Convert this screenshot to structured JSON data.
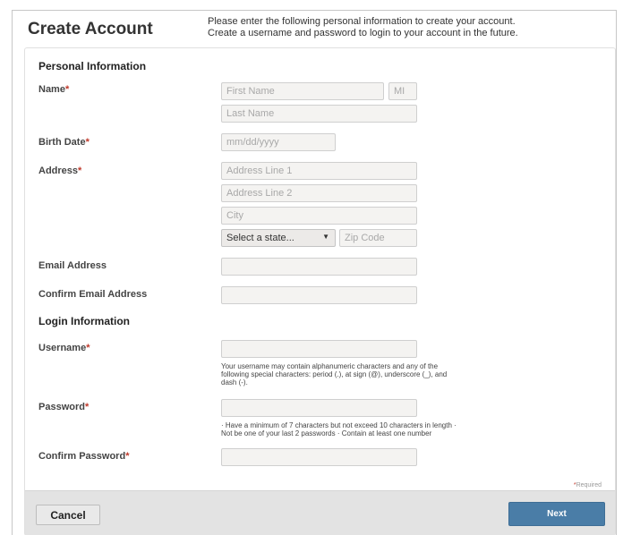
{
  "header": {
    "title": "Create Account",
    "intro_line1": "Please enter the following personal information to create your account.",
    "intro_line2": "Create a username and password to login to your account in the future."
  },
  "personal": {
    "section_title": "Personal Information",
    "name_label": "Name",
    "first_name_placeholder": "First Name",
    "mi_placeholder": "MI",
    "last_name_placeholder": "Last Name",
    "birth_date_label": "Birth Date",
    "birth_date_placeholder": "mm/dd/yyyy",
    "address_label": "Address",
    "address1_placeholder": "Address Line 1",
    "address2_placeholder": "Address Line 2",
    "city_placeholder": "City",
    "state_selected": "Select a state...",
    "zip_placeholder": "Zip Code",
    "email_label": "Email Address",
    "confirm_email_label": "Confirm Email Address"
  },
  "login": {
    "section_title": "Login Information",
    "username_label": "Username",
    "username_hint_line1": "Your username may contain alphanumeric characters and any of the",
    "username_hint_line2": "following special characters: period (.), at sign (@), underscore (_), and",
    "username_hint_line3": "dash (-).",
    "password_label": "Password",
    "password_hint_line1": "· Have a minimum of 7 characters but not exceed 10 characters in length ·",
    "password_hint_line2": "Not be one of your last 2 passwords · Contain at least one number",
    "confirm_password_label": "Confirm Password"
  },
  "required_marker": "*",
  "required_note": "Required",
  "footer": {
    "cancel_label": "Cancel",
    "next_label": "Next"
  },
  "colors": {
    "required": "#c0392b",
    "primary_button": "#4a7da7",
    "footer_bg": "#e3e3e3",
    "input_bg": "#f4f3f1"
  }
}
